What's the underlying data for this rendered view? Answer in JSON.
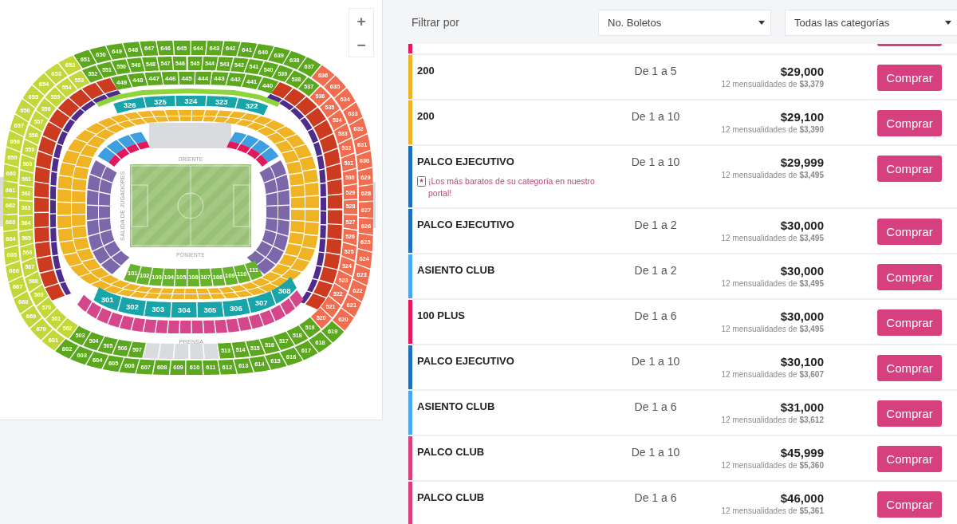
{
  "seat_map": {
    "zoom_controls": [
      {
        "label": "+"
      },
      {
        "label": "−"
      }
    ],
    "labels": [
      {
        "kind": "top",
        "text": "ORIENTE"
      },
      {
        "kind": "tunnel",
        "text": "SALIDA DE JUGADORES"
      },
      {
        "kind": "bottom",
        "text": "PONIENTE"
      },
      {
        "kind": "press",
        "text": "PRENSA"
      }
    ],
    "tiers": [
      {
        "groups": [
          {
            "color": "#5ba71d",
            "sections": [
              "651",
              "650",
              "649",
              "648",
              "647",
              "646",
              "645",
              "644",
              "643",
              "642",
              "641",
              "640",
              "639",
              "638",
              "637"
            ]
          },
          {
            "color": "#c2d83a",
            "sections": [
              "652",
              "653",
              "654",
              "655",
              "656",
              "657",
              "658",
              "659",
              "660",
              "661",
              "662",
              "663",
              "664",
              "665",
              "666",
              "667",
              "668",
              "669",
              "670",
              "601"
            ]
          },
          {
            "color": "#f26d50",
            "sections": [
              "636",
              "635",
              "634",
              "633",
              "632",
              "631",
              "630",
              "629",
              "628",
              "627",
              "626",
              "625",
              "624",
              "623",
              "622",
              "621",
              "620"
            ]
          },
          {
            "color": "#5ba71d",
            "sections": [
              "602",
              "603",
              "604",
              "605",
              "606",
              "607",
              "608",
              "609",
              "610",
              "611",
              "612",
              "613",
              "614",
              "615",
              "616",
              "617",
              "618",
              "619"
            ]
          }
        ]
      },
      {
        "groups": [
          {
            "color": "#5ba71d",
            "sections": [
              "552",
              "551",
              "550",
              "549",
              "548",
              "547",
              "546",
              "545",
              "544",
              "543",
              "542",
              "541",
              "540",
              "539",
              "538",
              "537"
            ]
          },
          {
            "color": "#c2d83a",
            "sections": [
              "553",
              "554",
              "555",
              "556",
              "557",
              "558",
              "559",
              "560",
              "561",
              "562",
              "563",
              "564",
              "565",
              "566",
              "567",
              "568",
              "569",
              "570",
              "501",
              "502"
            ]
          },
          {
            "color": "#f26d50",
            "sections": [
              "536",
              "535",
              "534",
              "533",
              "532",
              "531",
              "530",
              "529",
              "528",
              "527",
              "526",
              "525",
              "524",
              "523",
              "522",
              "521",
              "520"
            ]
          },
          {
            "color": "#5ba71d",
            "sections": [
              "503",
              "504",
              "505",
              "506",
              "507",
              "513",
              "514",
              "515",
              "516",
              "517",
              "518",
              "519"
            ]
          }
        ]
      },
      {
        "groups": [
          {
            "color": "#5ba71d",
            "sections": [
              "449",
              "448",
              "447",
              "446",
              "445",
              "444",
              "443",
              "442",
              "441",
              "440"
            ]
          }
        ]
      },
      {
        "groups": [
          {
            "color": "#17a5a9",
            "sections": [
              "326",
              "325",
              "324",
              "323",
              "322"
            ]
          }
        ]
      },
      {
        "groups": [
          {
            "color": "#66b22c",
            "sections": [
              "101",
              "102",
              "103",
              "104",
              "105",
              "106",
              "107",
              "108",
              "109",
              "110",
              "111"
            ]
          }
        ]
      },
      {
        "groups": [
          {
            "color": "#17a5a9",
            "sections": [
              "301",
              "302",
              "303",
              "304",
              "305",
              "306",
              "307",
              "308"
            ]
          }
        ]
      }
    ]
  },
  "filter": {
    "label": "Filtrar por",
    "selects": [
      {
        "value": "No. Boletos"
      },
      {
        "value": "Todas las categorías"
      }
    ]
  },
  "partial_row": {
    "color": "#e8175d"
  },
  "listings": [
    {
      "name": "200",
      "range": "De 1 a 5",
      "price": "$29,000",
      "installments": "12 mensualidades de **$3,379**",
      "button": "Comprar",
      "color": "#f0b323"
    },
    {
      "name": "200",
      "range": "De 1 a 10",
      "price": "$29,100",
      "installments": "12 mensualidades de **$3,390**",
      "button": "Comprar",
      "color": "#f0b323"
    },
    {
      "name": "PALCO EJECUTIVO",
      "promo": "¡Los más baratos de su categoría en nuestro portal!",
      "range": "De 1 a 10",
      "price": "$29,999",
      "installments": "12 mensualidades de **$3,495**",
      "button": "Comprar",
      "color": "#1e6fb8"
    },
    {
      "name": "PALCO EJECUTIVO",
      "range": "De 1 a 2",
      "price": "$30,000",
      "installments": "12 mensualidades de **$3,495**",
      "button": "Comprar",
      "color": "#1e6fb8"
    },
    {
      "name": "ASIENTO CLUB",
      "range": "De 1 a 2",
      "price": "$30,000",
      "installments": "12 mensualidades de **$3,495**",
      "button": "Comprar",
      "color": "#4aa8ea"
    },
    {
      "name": "100 PLUS",
      "range": "De 1 a 6",
      "price": "$30,000",
      "installments": "12 mensualidades de **$3,495**",
      "button": "Comprar",
      "color": "#e8175d"
    },
    {
      "name": "PALCO EJECUTIVO",
      "range": "De 1 a 10",
      "price": "$30,100",
      "installments": "12 mensualidades de **$3,607**",
      "button": "Comprar",
      "color": "#1e6fb8"
    },
    {
      "name": "ASIENTO CLUB",
      "range": "De 1 a 6",
      "price": "$31,000",
      "installments": "12 mensualidades de **$3,612**",
      "button": "Comprar",
      "color": "#4aa8ea"
    },
    {
      "name": "PALCO CLUB",
      "range": "De 1 a 10",
      "price": "$45,999",
      "installments": "12 mensualidades de **$5,360**",
      "button": "Comprar",
      "color": "#d6407f"
    },
    {
      "name": "PALCO CLUB",
      "range": "De 1 a 6",
      "price": "$46,000",
      "installments": "12 mensualidades de **$5,361**",
      "button": "Comprar",
      "color": "#d6407f"
    }
  ]
}
